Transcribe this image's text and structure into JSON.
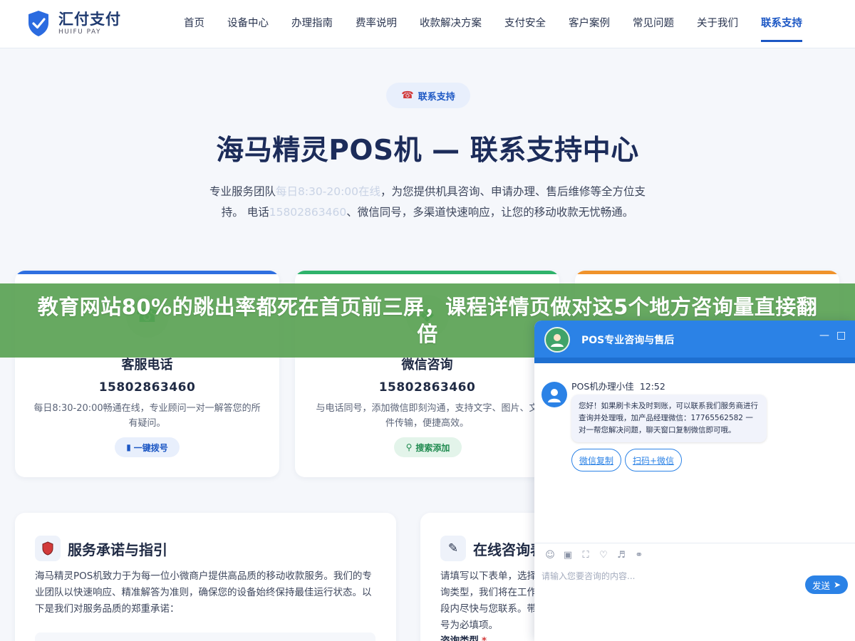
{
  "colors": {
    "primary": "#1c57c4",
    "banner": "#56a050",
    "chat_blue": "#2b82e6",
    "card1_bar": "#2f6fe0",
    "card2_bar": "#2fb36b",
    "card3_bar": "#f0932b"
  },
  "header": {
    "logo_cn": "汇付支付",
    "logo_en": "HUIFU PAY",
    "logo_icon": "shield-check-icon",
    "nav": [
      {
        "label": "首页",
        "active": false
      },
      {
        "label": "设备中心",
        "active": false
      },
      {
        "label": "办理指南",
        "active": false
      },
      {
        "label": "费率说明",
        "active": false
      },
      {
        "label": "收款解决方案",
        "active": false
      },
      {
        "label": "支付安全",
        "active": false
      },
      {
        "label": "客户案例",
        "active": false
      },
      {
        "label": "常见问题",
        "active": false
      },
      {
        "label": "关于我们",
        "active": false
      },
      {
        "label": "联系支持",
        "active": true
      }
    ]
  },
  "hero": {
    "badge_icon": "phone-icon",
    "badge": "联系支持",
    "title": "海马精灵POS机 — 联系支持中心",
    "desc_1": "专业服务团队",
    "desc_faded_1": "每日8:30-20:00在线",
    "desc_2": "，为您提供机具咨询、申请办理、售后维修等全方位支持。 电话",
    "desc_faded_2": "15802863460",
    "desc_3": "、微信同号，多渠道快速响应，让您的移动收款无忧畅通。"
  },
  "cards": [
    {
      "icon": "phone-icon",
      "title": "客服电话",
      "number": "15802863460",
      "desc": "每日8:30-20:00畅通在线，专业顾问一对一解答您的所有疑问。",
      "button_icon": "mobile-icon",
      "button": "一键拨号"
    },
    {
      "icon": "wechat-icon",
      "title": "微信咨询",
      "number": "15802863460",
      "desc": "与电话同号，添加微信即刻沟通，支持文字、图片、文件传输，便捷高效。",
      "button_icon": "search-icon",
      "button": "搜索添加"
    }
  ],
  "lower": {
    "left": {
      "icon": "shield-icon",
      "title": "服务承诺与指引",
      "body": "海马精灵POS机致力于为每一位小微商户提供高品质的移动收款服务。我们的专业团队以快速响应、精准解答为准则，确保您的设备始终保持最佳运行状态。以下是我们对服务品质的郑重承诺："
    },
    "right": {
      "icon": "memo-icon",
      "title": "在线咨询表",
      "body": "请填写以下表单，选择咨询类型，我们将在工作时段内尽快与您联系。带 * 号为必填项。",
      "label": "咨询类型",
      "required": "*"
    }
  },
  "banner": {
    "text": "教育网站80%的跳出率都死在首页前三屏，课程详情页做对这5个地方咨询量直接翻倍"
  },
  "chat": {
    "title": "POS专业咨询与售后",
    "minimize": "—",
    "maximize": "□",
    "bot_name": "POS机办理小佳",
    "time": "12:52",
    "message": "您好！如果刷卡未及时到账，可以联系我们服务商进行查询并处理哦，加产品经理微信：17765562582 一对一帮您解决问题，聊天窗口复制微信即可哦。",
    "chips": [
      "微信复制",
      "扫码+微信"
    ],
    "tools": [
      "emoji-icon",
      "image-icon",
      "screenshot-icon",
      "rating-icon",
      "voice-icon",
      "chat-history-icon"
    ],
    "input_placeholder": "请输入您要咨询的内容...",
    "send": "发送"
  }
}
